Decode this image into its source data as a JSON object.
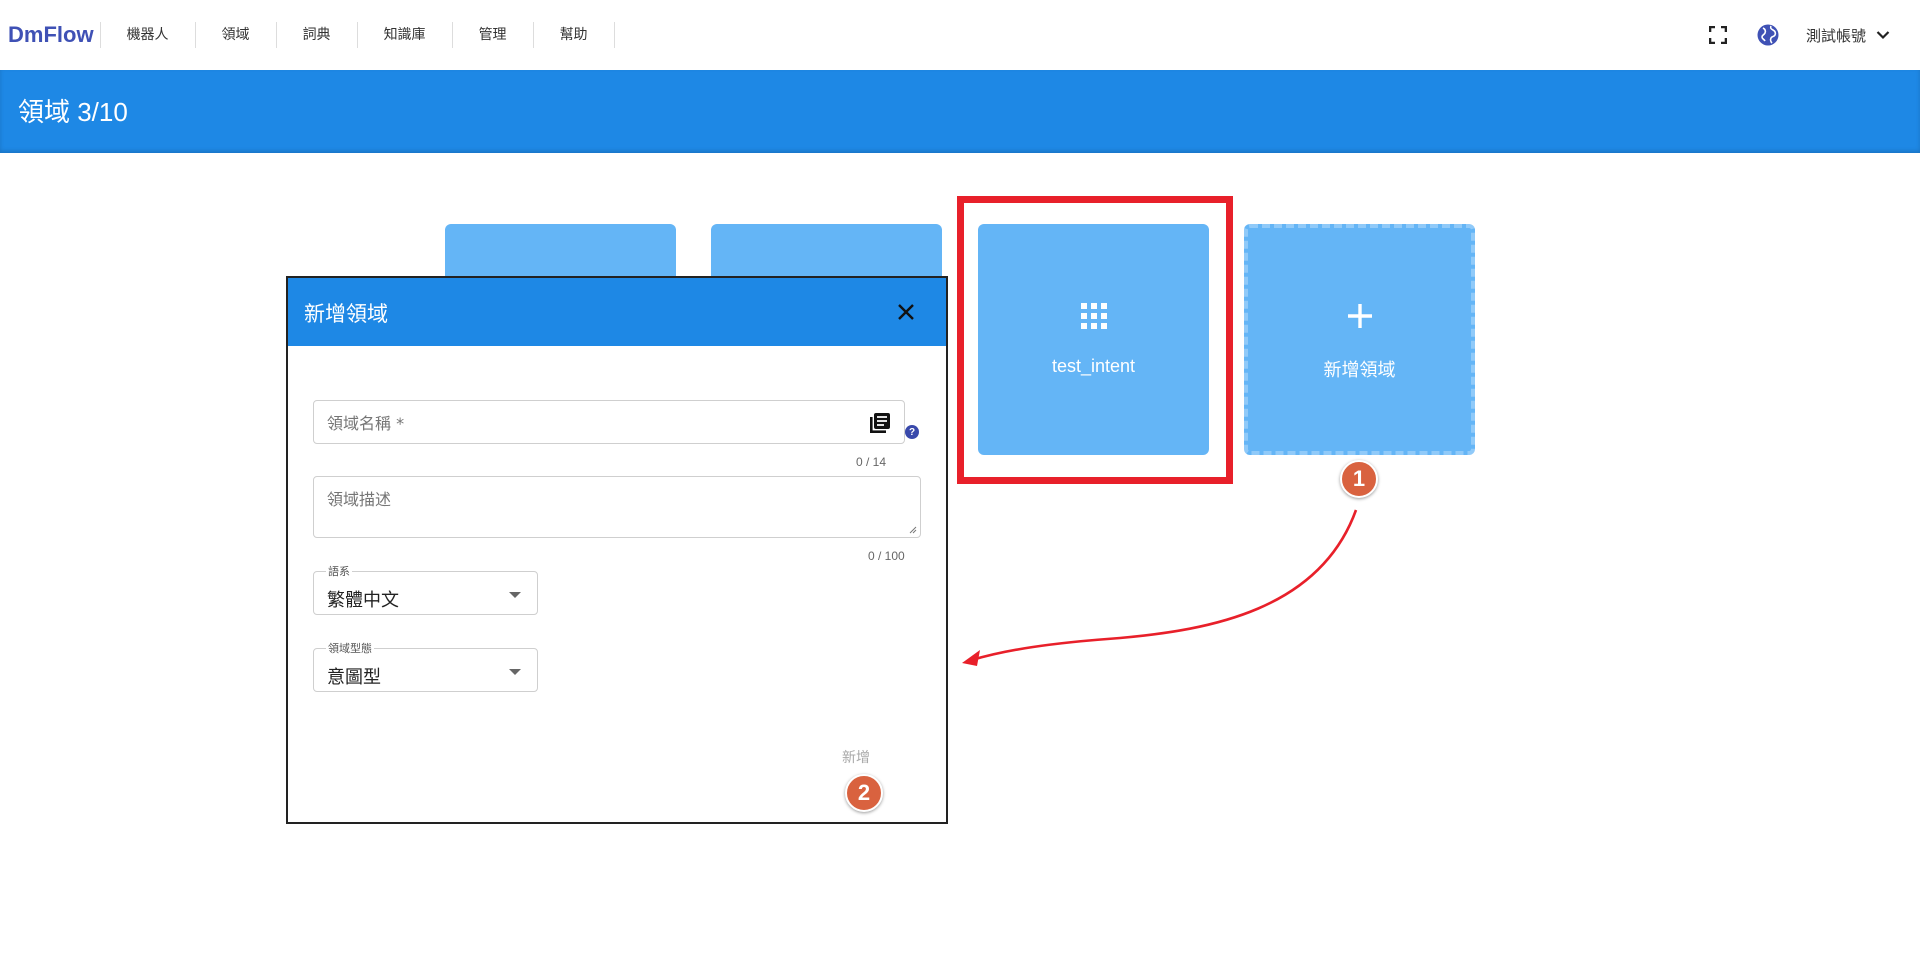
{
  "brand": "DmFlow",
  "nav": {
    "items": [
      {
        "label": "機器人"
      },
      {
        "label": "領域"
      },
      {
        "label": "詞典"
      },
      {
        "label": "知識庫"
      },
      {
        "label": "管理"
      },
      {
        "label": "幫助"
      }
    ]
  },
  "account": {
    "label": "測試帳號"
  },
  "page": {
    "title": "領域 3/10"
  },
  "cards": {
    "existing_label": "test_intent",
    "add_label": "新增領域"
  },
  "dialog": {
    "title": "新增領域",
    "name_placeholder": "領域名稱 *",
    "name_counter": "0 / 14",
    "desc_placeholder": "領域描述",
    "desc_counter": "0 / 100",
    "lang_label": "語系",
    "lang_value": "繁體中文",
    "type_label": "領域型態",
    "type_value": "意圖型",
    "submit_label": "新增",
    "help_glyph": "?"
  },
  "steps": {
    "one": "1",
    "two": "2"
  },
  "colors": {
    "primary": "#1e88e5",
    "card": "#64b5f6",
    "highlight": "#e8202a",
    "badge": "#d9623f",
    "brand": "#3f51b5"
  }
}
